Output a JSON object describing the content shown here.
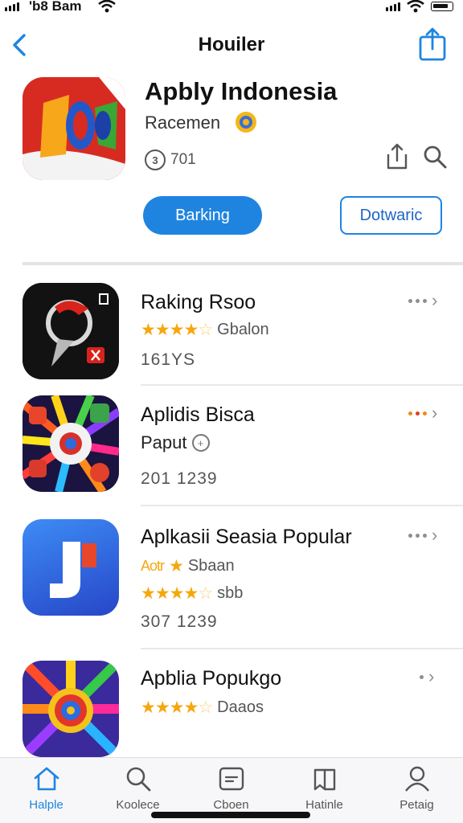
{
  "status": {
    "carrier": "'b8 Bam"
  },
  "nav": {
    "title": "Houiler"
  },
  "hero": {
    "title": "Apbly Indonesia",
    "subtitle": "Racemen",
    "meta": "701",
    "primary_button": "Barking",
    "secondary_button": "Dotwaric"
  },
  "list": [
    {
      "title": "Raking Rsoo",
      "rating": 3.5,
      "rating_text": "Gbalon",
      "stat": "161YS"
    },
    {
      "title": "Aplidis Bisca",
      "subtitle": "Paput",
      "stat": "201 1239"
    },
    {
      "title": "Aplkasii Seasia Popular",
      "line2_prefix": "Aotr",
      "line2_text": "Sbaan",
      "rating": 4.5,
      "rating_text": "sbb",
      "stat": "307 1239"
    },
    {
      "title": "Apblia Popukgo",
      "rating": 4.5,
      "rating_text": "Daaos"
    }
  ],
  "tabs": [
    {
      "label": "Halple",
      "icon": "home-icon"
    },
    {
      "label": "Koolece",
      "icon": "search-icon"
    },
    {
      "label": "Cboen",
      "icon": "wallet-icon"
    },
    {
      "label": "Hatinle",
      "icon": "bookmark-icon"
    },
    {
      "label": "Petaig",
      "icon": "person-icon"
    }
  ],
  "colors": {
    "accent": "#1f84e0",
    "star": "#f5a70c"
  }
}
